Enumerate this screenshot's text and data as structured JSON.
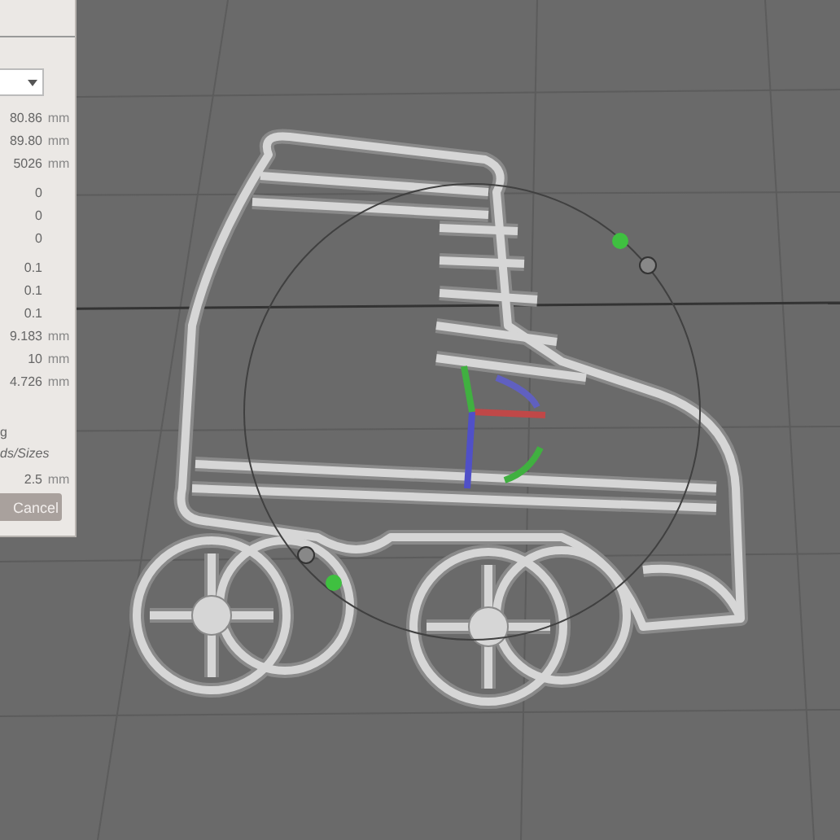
{
  "panel": {
    "rows": [
      {
        "value": "80.86",
        "unit": "mm"
      },
      {
        "value": "89.80",
        "unit": "mm"
      },
      {
        "value": "5026",
        "unit": "mm"
      },
      {
        "value": "0",
        "unit": ""
      },
      {
        "value": "0",
        "unit": ""
      },
      {
        "value": "0",
        "unit": ""
      },
      {
        "value": "0.1",
        "unit": ""
      },
      {
        "value": "0.1",
        "unit": ""
      },
      {
        "value": "0.1",
        "unit": ""
      },
      {
        "value": "9.183",
        "unit": "mm"
      },
      {
        "value": "10",
        "unit": "mm"
      },
      {
        "value": "4.726",
        "unit": "mm"
      }
    ],
    "option_label": "g",
    "option_hint": "ds/Sizes",
    "spacing": {
      "value": "2.5",
      "unit": "mm"
    },
    "cancel_button": "Cancel"
  }
}
